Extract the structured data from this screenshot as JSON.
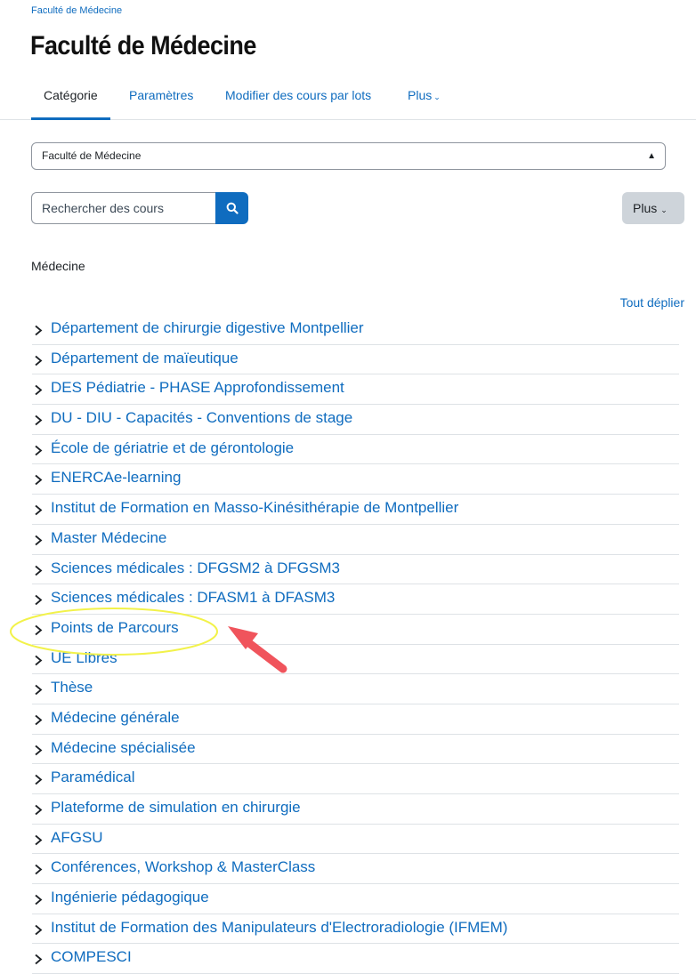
{
  "breadcrumb": "Faculté de Médecine",
  "page_title": "Faculté de Médecine",
  "tabs": [
    {
      "label": "Catégorie",
      "active": true
    },
    {
      "label": "Paramètres"
    },
    {
      "label": "Modifier des cours par lots"
    },
    {
      "label": "Plus"
    }
  ],
  "category_select": {
    "value": "Faculté de Médecine"
  },
  "search": {
    "placeholder": "Rechercher des cours"
  },
  "more_button": "Plus",
  "section_title": "Médecine",
  "expand_all": "Tout déplier",
  "categories": [
    "Département de chirurgie digestive Montpellier",
    "Département de maïeutique",
    "DES Pédiatrie - PHASE Approfondissement",
    "DU - DIU - Capacités - Conventions de stage",
    "École de gériatrie et de gérontologie",
    "ENERCAe-learning",
    "Institut de Formation en Masso-Kinésithérapie de Montpellier",
    "Master Médecine",
    "Sciences médicales : DFGSM2 à DFGSM3",
    "Sciences médicales : DFASM1 à DFASM3",
    "Points de Parcours",
    "UE Libres",
    "Thèse",
    "Médecine générale",
    "Médecine spécialisée",
    "Paramédical",
    "Plateforme de simulation en chirurgie",
    "AFGSU",
    "Conférences, Workshop & MasterClass",
    "Ingénierie pédagogique",
    "Institut de Formation des Manipulateurs d'Electroradiologie (IFMEM)",
    "COMPESCI"
  ],
  "colors": {
    "link": "#0f6cbf",
    "highlight_ellipse": "#f2f24a",
    "arrow": "#f0545c"
  }
}
